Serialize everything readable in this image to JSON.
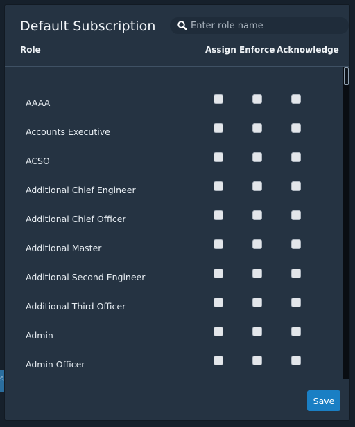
{
  "modal": {
    "title": "Default Subscription",
    "search": {
      "placeholder": "Enter role name",
      "value": ""
    },
    "columns": {
      "role": "Role",
      "assign": "Assign",
      "enforce": "Enforce",
      "acknowledge": "Acknowledge"
    },
    "rows": [
      {
        "label": "AAAA",
        "assign": false,
        "enforce": false,
        "acknowledge": false
      },
      {
        "label": "Accounts Executive",
        "assign": false,
        "enforce": false,
        "acknowledge": false
      },
      {
        "label": "ACSO",
        "assign": false,
        "enforce": false,
        "acknowledge": false
      },
      {
        "label": "Additional Chief Engineer",
        "assign": false,
        "enforce": false,
        "acknowledge": false
      },
      {
        "label": "Additional Chief Officer",
        "assign": false,
        "enforce": false,
        "acknowledge": false
      },
      {
        "label": "Additional Master",
        "assign": false,
        "enforce": false,
        "acknowledge": false
      },
      {
        "label": "Additional Second Engineer",
        "assign": false,
        "enforce": false,
        "acknowledge": false
      },
      {
        "label": "Additional Third Officer",
        "assign": false,
        "enforce": false,
        "acknowledge": false
      },
      {
        "label": "Admin",
        "assign": false,
        "enforce": false,
        "acknowledge": false
      },
      {
        "label": "Admin Officer",
        "assign": false,
        "enforce": false,
        "acknowledge": false
      }
    ],
    "save_label": "Save"
  },
  "background": {
    "edge_text": "S"
  },
  "icons": {
    "search": "search-icon"
  },
  "colors": {
    "modal_bg": "#253342",
    "accent": "#1a7fc4",
    "checkbox": "#e3e6ea"
  }
}
